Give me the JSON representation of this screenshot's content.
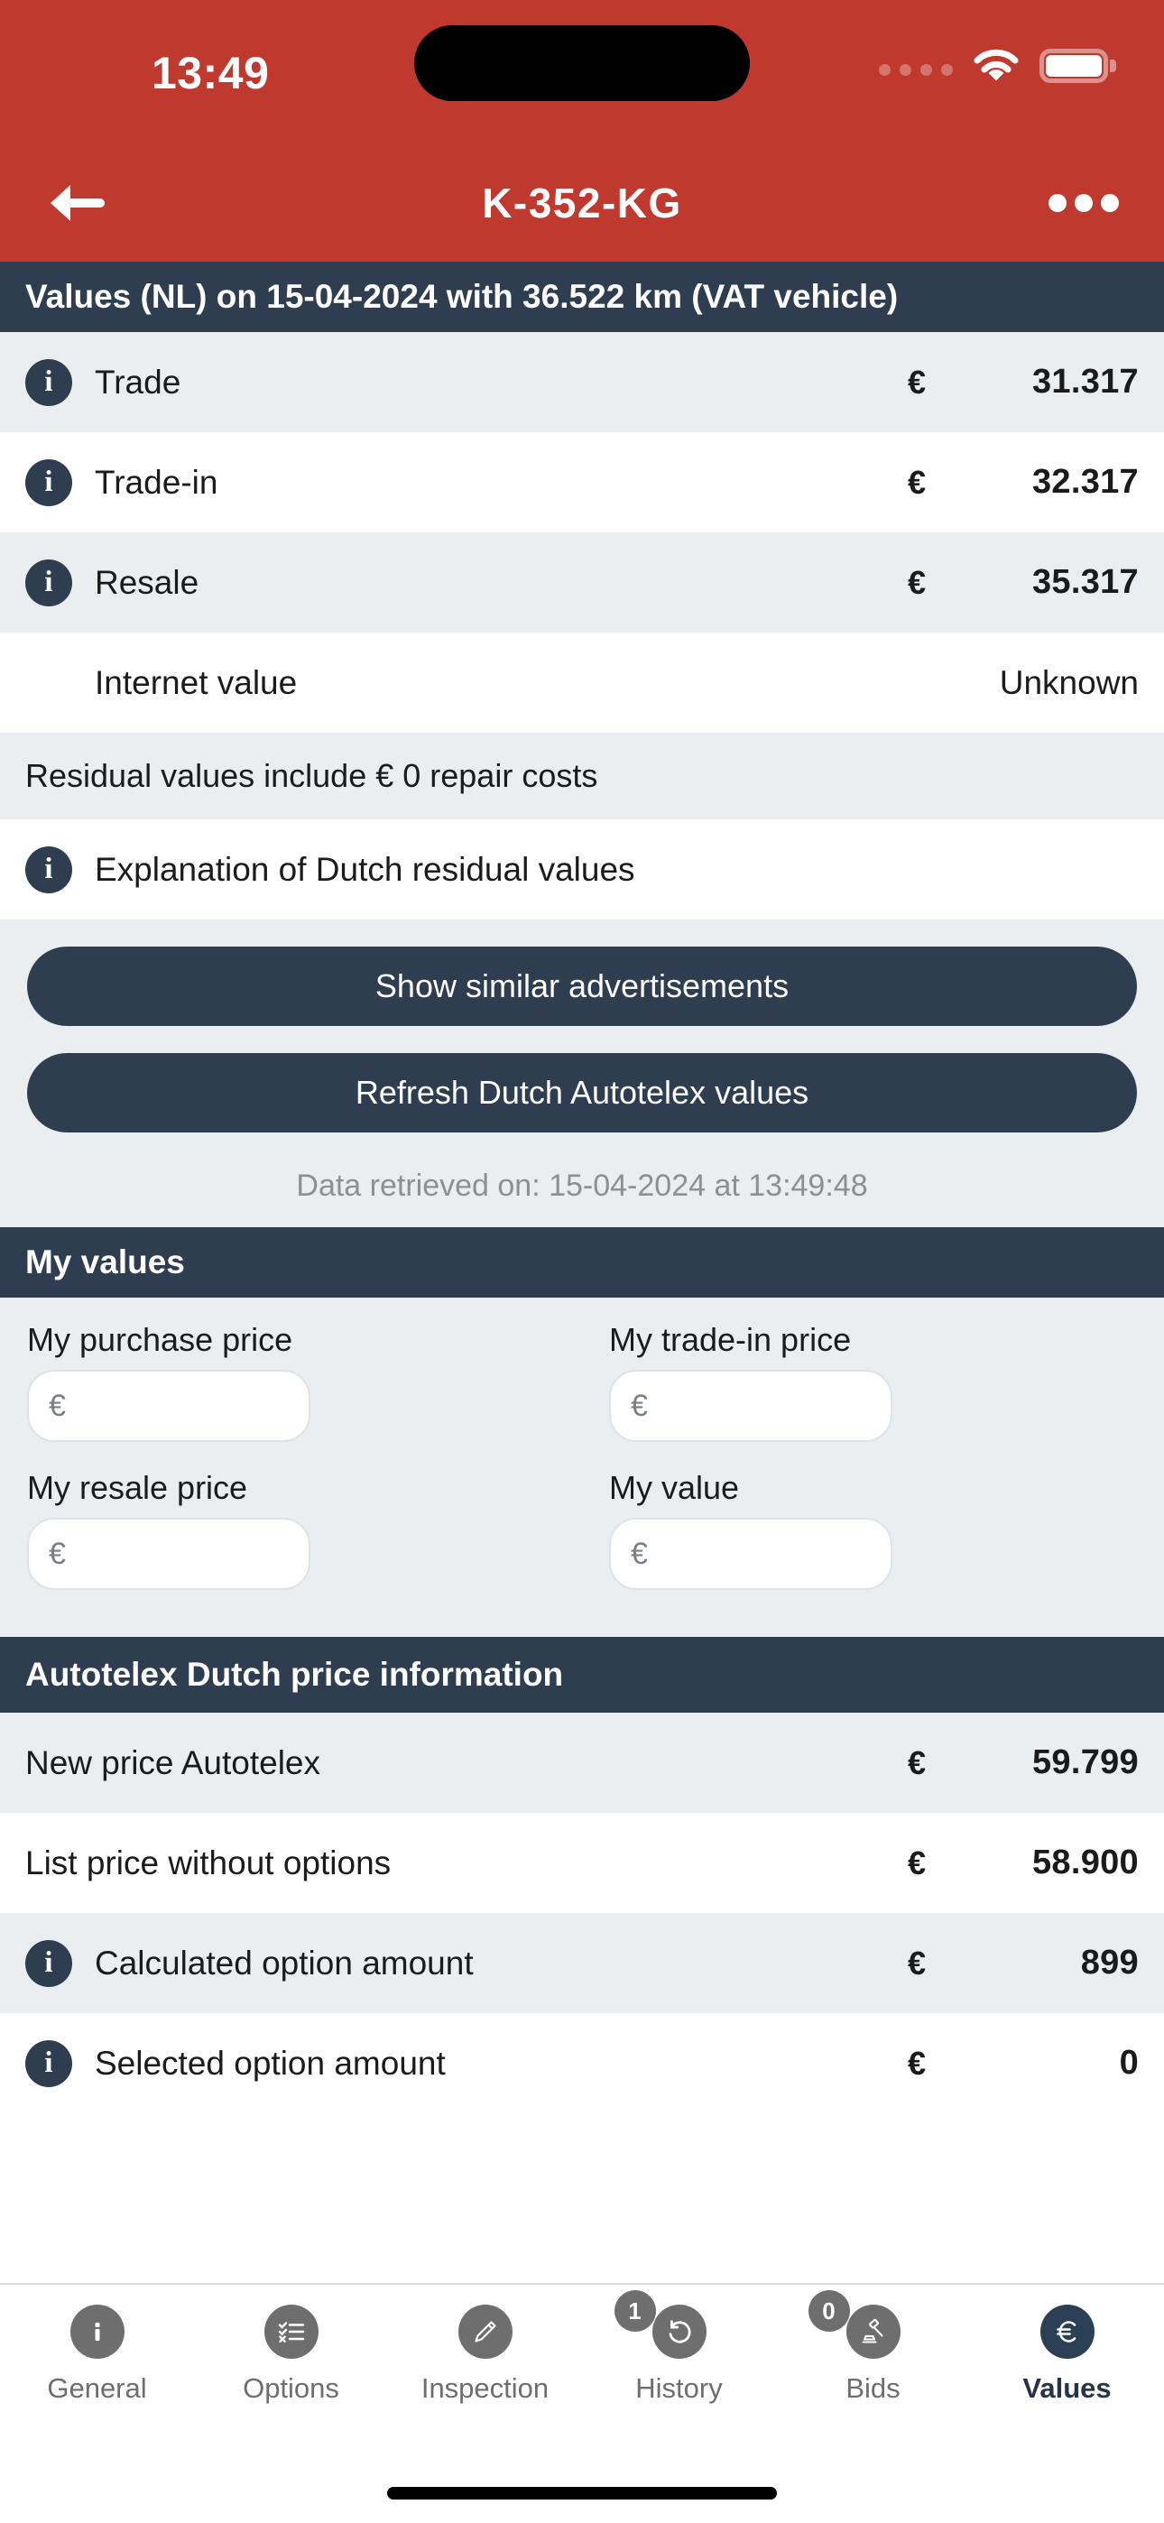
{
  "colors": {
    "brand_red": "#c0392f",
    "navy": "#2e3e50",
    "row_alt": "#eaeef0",
    "tab_inactive": "#6e6e6e"
  },
  "status_bar": {
    "time": "13:49",
    "cellular_icon": "cellular-bars-icon",
    "wifi_icon": "wifi-icon",
    "battery_icon": "battery-icon"
  },
  "navbar": {
    "back_icon": "back-arrow-icon",
    "title": "K-352-KG",
    "more_icon": "more-options-icon"
  },
  "values_section": {
    "header": "Values (NL) on 15-04-2024 with 36.522 km (VAT vehicle)",
    "rows": [
      {
        "info": true,
        "label": "Trade",
        "currency": "€",
        "amount": "31.317"
      },
      {
        "info": true,
        "label": "Trade-in",
        "currency": "€",
        "amount": "32.317"
      },
      {
        "info": true,
        "label": "Resale",
        "currency": "€",
        "amount": "35.317"
      },
      {
        "info": false,
        "label": "Internet value",
        "currency": "",
        "amount": "Unknown"
      }
    ],
    "repair_note": "Residual values include € 0 repair costs",
    "explanation_link": "Explanation of Dutch residual values"
  },
  "actions": {
    "show_similar": "Show similar advertisements",
    "refresh_values": "Refresh Dutch Autotelex values",
    "retrieved": "Data retrieved on: 15-04-2024 at 13:49:48"
  },
  "my_values": {
    "header": "My values",
    "fields": [
      {
        "label": "My purchase price",
        "placeholder": "",
        "value": "",
        "prefix": "€"
      },
      {
        "label": "My trade-in price",
        "placeholder": "",
        "value": "",
        "prefix": "€"
      },
      {
        "label": "My resale price",
        "placeholder": "",
        "value": "",
        "prefix": "€"
      },
      {
        "label": "My value",
        "placeholder": "",
        "value": "",
        "prefix": "€"
      }
    ]
  },
  "price_info": {
    "header": "Autotelex Dutch price information",
    "rows": [
      {
        "info": false,
        "label": "New price Autotelex",
        "currency": "€",
        "amount": "59.799"
      },
      {
        "info": false,
        "label": "List price without options",
        "currency": "€",
        "amount": "58.900"
      },
      {
        "info": true,
        "label": "Calculated option amount",
        "currency": "€",
        "amount": "899"
      },
      {
        "info": true,
        "label": "Selected option amount",
        "currency": "€",
        "amount": "0"
      }
    ]
  },
  "tabbar": {
    "items": [
      {
        "label": "General",
        "icon": "info-icon",
        "badge": "",
        "active": false
      },
      {
        "label": "Options",
        "icon": "checklist-icon",
        "badge": "",
        "active": false
      },
      {
        "label": "Inspection",
        "icon": "pencil-icon",
        "badge": "",
        "active": false
      },
      {
        "label": "History",
        "icon": "history-rewind-icon",
        "badge": "1",
        "active": false
      },
      {
        "label": "Bids",
        "icon": "gavel-icon",
        "badge": "0",
        "active": false
      },
      {
        "label": "Values",
        "icon": "euro-icon",
        "badge": "",
        "active": true
      }
    ]
  }
}
